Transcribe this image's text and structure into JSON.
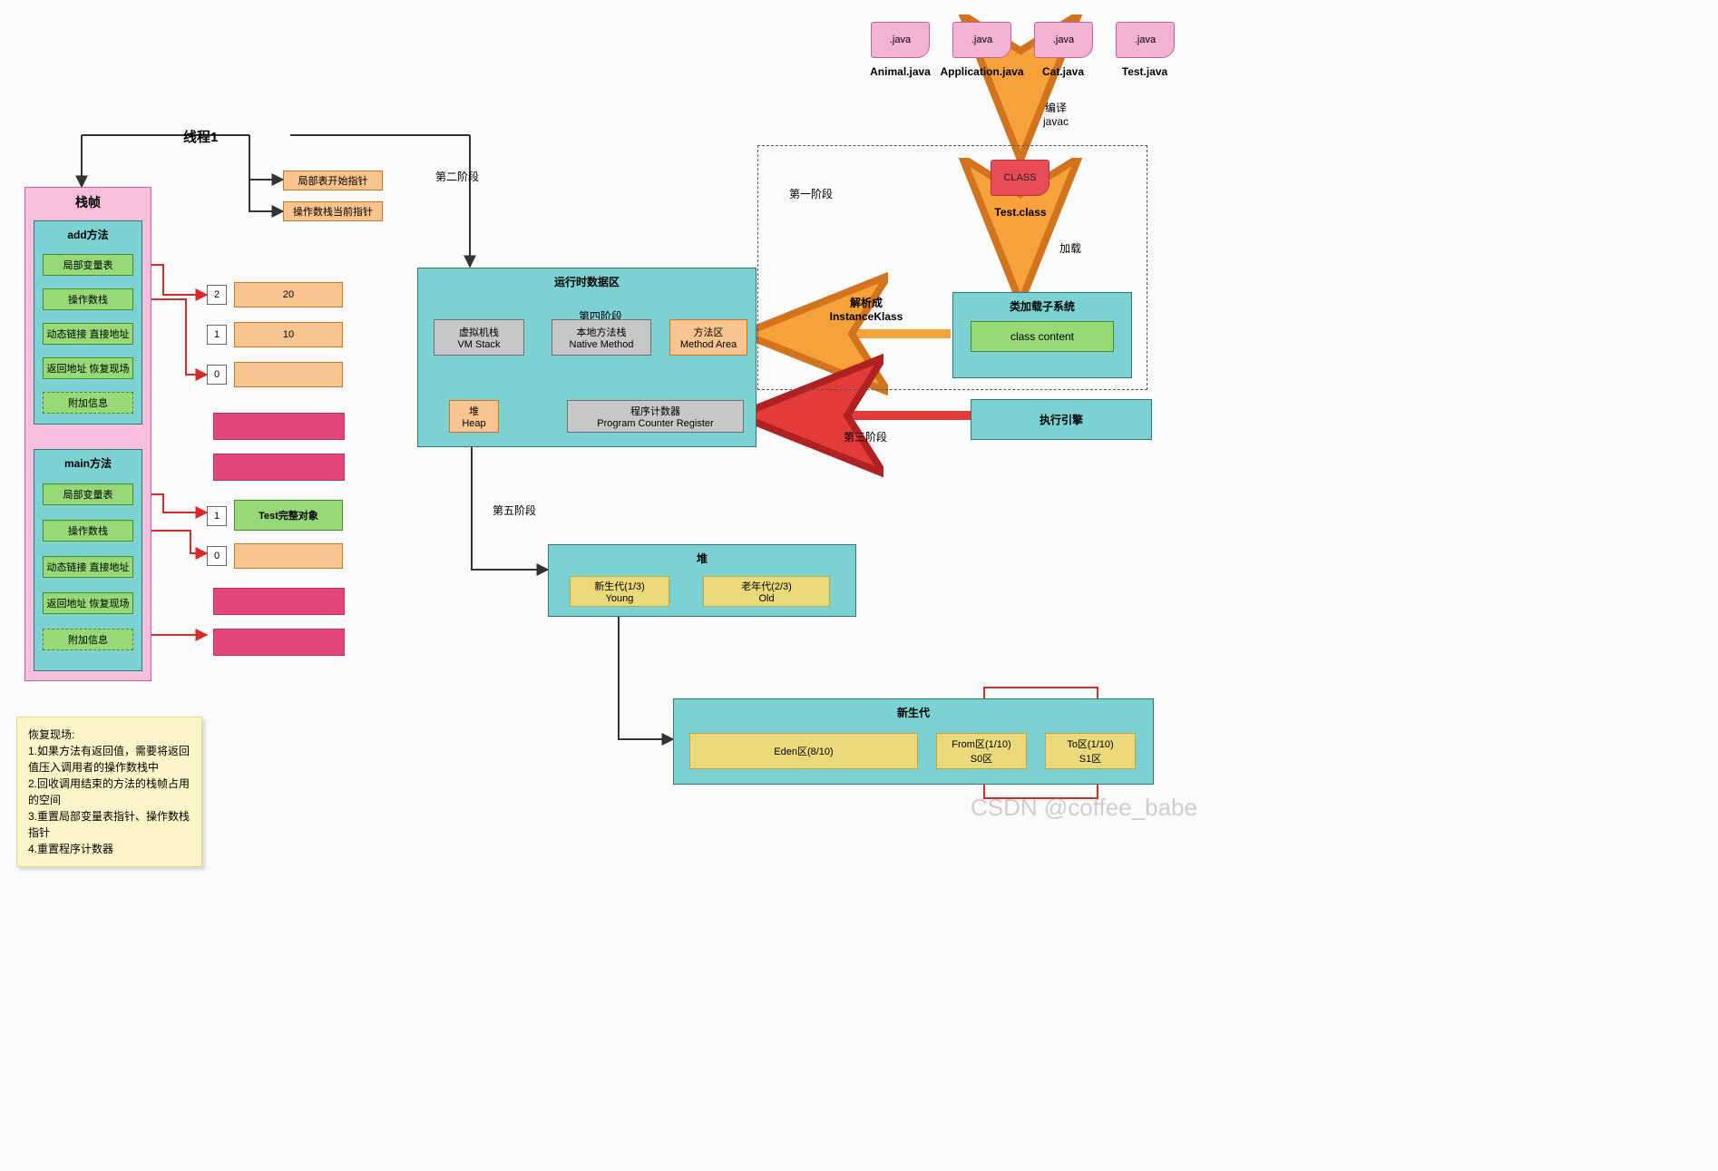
{
  "files": {
    "ext": ".java",
    "names": [
      "Animal.java",
      "Application.java",
      "Cat.java",
      "Test.java"
    ],
    "compile_label": "编译\njavac",
    "class_tag": "CLASS",
    "class_file": "Test.class",
    "load_label": "加载"
  },
  "classloader": {
    "title": "类加载子系统",
    "content": "class content"
  },
  "parse_label": "解析成\nInstanceKlass",
  "exec_engine": "执行引擎",
  "stage1": "第一阶段",
  "stage2": "第二阶段",
  "stage3": "第三阶段",
  "stage4": "第四阶段",
  "stage5": "第五阶段",
  "runtime": {
    "title": "运行时数据区",
    "vm_stack": [
      "虚拟机栈",
      "VM Stack"
    ],
    "native": [
      "本地方法栈",
      "Native Method"
    ],
    "method_area": [
      "方法区",
      "Method Area"
    ],
    "heap": [
      "堆",
      "Heap"
    ],
    "pcr": [
      "程序计数器",
      "Program Counter Register"
    ]
  },
  "heap_detail": {
    "title": "堆",
    "young": [
      "新生代(1/3)",
      "Young"
    ],
    "old": [
      "老年代(2/3)",
      "Old"
    ]
  },
  "young_detail": {
    "title": "新生代",
    "eden": "Eden区(8/10)",
    "from": [
      "From区(1/10)",
      "S0区"
    ],
    "to": [
      "To区(1/10)",
      "S1区"
    ]
  },
  "thread": {
    "label": "线程1",
    "ptr1": "局部表开始指针",
    "ptr2": "操作数栈当前指针"
  },
  "stackframe": {
    "title": "栈帧",
    "methods": {
      "add": {
        "title": "add方法",
        "rows": [
          "局部变量表",
          "操作数栈",
          "动态链接 直接地址",
          "返回地址 恢复现场",
          "附加信息"
        ]
      },
      "main": {
        "title": "main方法",
        "rows": [
          "局部变量表",
          "操作数栈",
          "动态链接 直接地址",
          "返回地址 恢复现场",
          "附加信息"
        ]
      }
    }
  },
  "operand_add": {
    "indices": [
      "2",
      "1",
      "0"
    ],
    "values": [
      "20",
      "10",
      ""
    ]
  },
  "operand_main": {
    "indices": [
      "1",
      "0"
    ],
    "values": [
      "Test完整对象",
      ""
    ]
  },
  "note": "恢复现场:\n1.如果方法有返回值，需要将返回值压入调用者的操作数栈中\n2.回收调用结束的方法的栈帧占用的空间\n3.重置局部变量表指针、操作数栈指针\n4.重置程序计数器",
  "watermark": "CSDN @coffee_babe"
}
